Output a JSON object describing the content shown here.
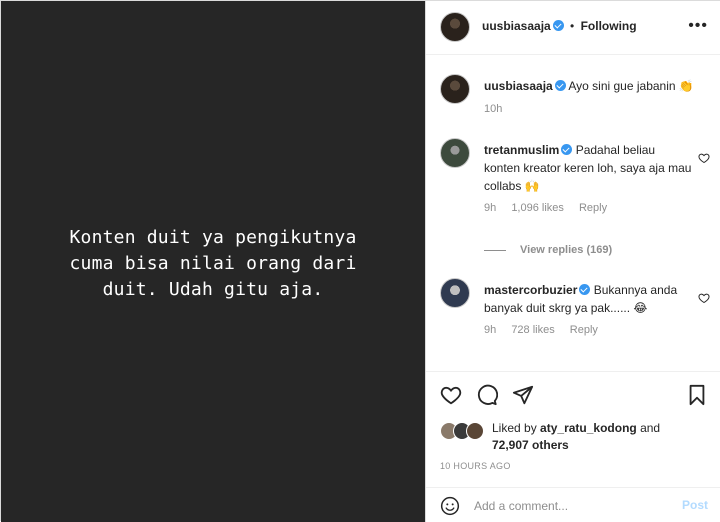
{
  "media": {
    "text": "Konten duit ya pengikutnya\ncuma bisa nilai orang dari\nduit. Udah gitu aja."
  },
  "header": {
    "username": "uusbiasaaja",
    "separator": "•",
    "follow_status": "Following",
    "more_icon": "more-horizontal-icon"
  },
  "caption": {
    "username": "uusbiasaaja",
    "text": "Ayo sini gue jabanin 👏",
    "time": "10h"
  },
  "comments": [
    {
      "username": "tretanmuslim",
      "text": "Padahal beliau konten kreator keren loh, saya aja mau collabs 🙌",
      "time": "9h",
      "likes": "1,096 likes",
      "reply": "Reply"
    },
    {
      "username": "mastercorbuzier",
      "text": "Bukannya anda banyak duit skrg ya pak...... 😂",
      "time": "9h",
      "likes": "728 likes",
      "reply": "Reply"
    }
  ],
  "view_replies": "View replies (169)",
  "likes": {
    "prefix": "Liked by",
    "user": "aty_ratu_kodong",
    "and": "and",
    "others": "72,907 others"
  },
  "timestamp": "10 HOURS AGO",
  "add_comment": {
    "placeholder": "Add a comment...",
    "post_label": "Post"
  },
  "colors": {
    "media_bg": "#262626",
    "verified": "#3897f0",
    "post_disabled": "#b3dbff"
  }
}
